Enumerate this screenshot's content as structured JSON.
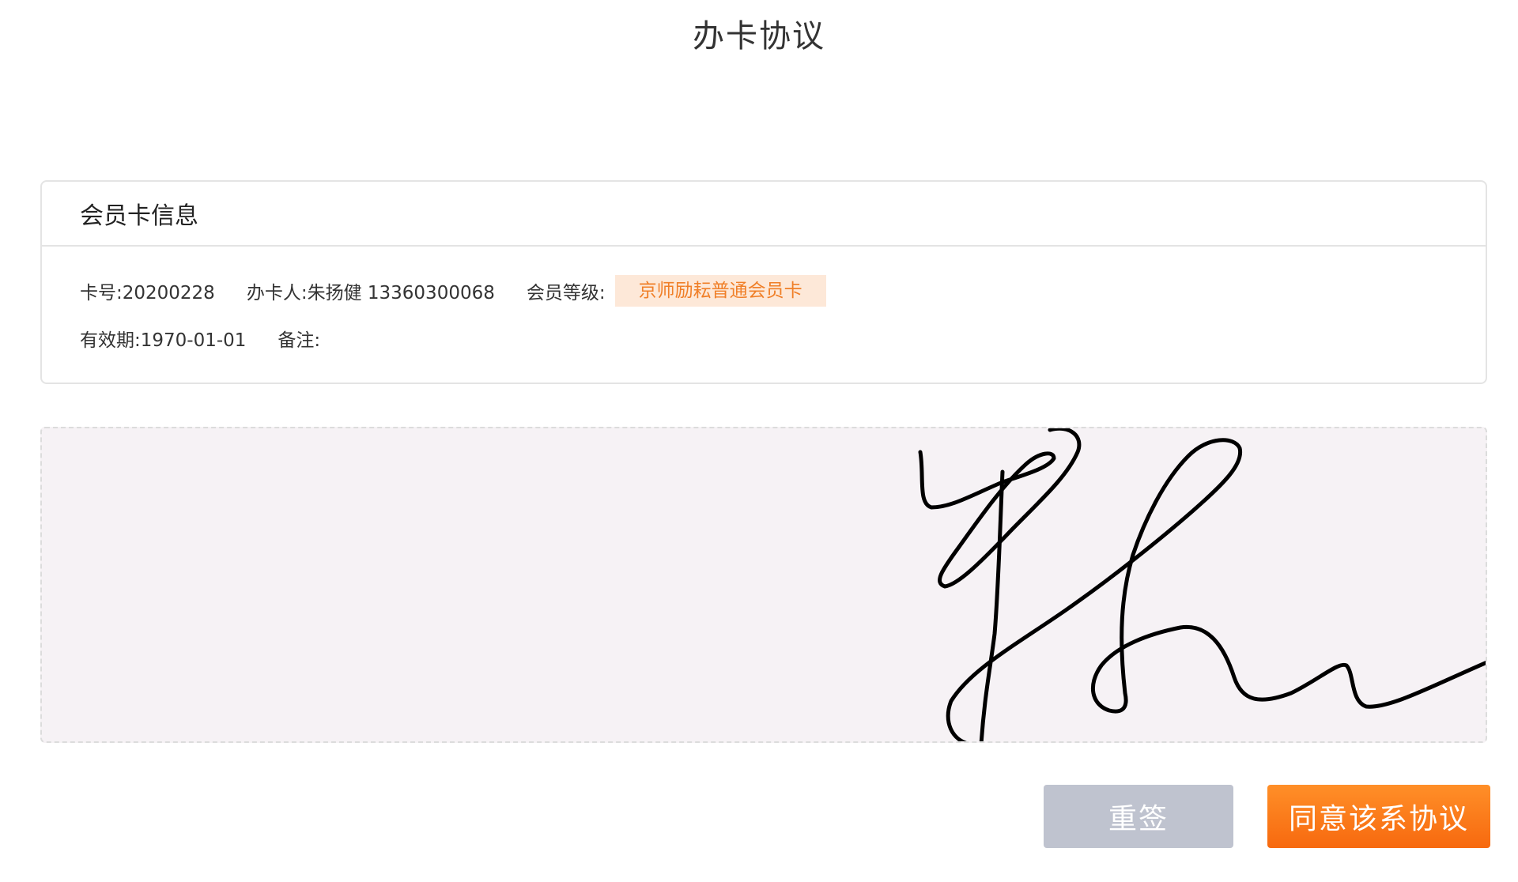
{
  "page": {
    "title": "办卡协议"
  },
  "card_info": {
    "header": "会员卡信息",
    "card_number": "卡号:20200228",
    "applicant": "办卡人:朱扬健 13360300068",
    "level_label": "会员等级:",
    "level_value": "京师励耘普通会员卡",
    "expiry": "有效期:1970-01-01",
    "remark": "备注:"
  },
  "signature": {
    "has_signature": true
  },
  "actions": {
    "resign_label": "重签",
    "agree_label": "同意该系协议"
  },
  "colors": {
    "accent_orange": "#f7690f",
    "badge_bg": "#fde8d8",
    "badge_text": "#f07f28",
    "resign_button": "#bfc3cf",
    "signature_bg": "#f6f2f5"
  }
}
